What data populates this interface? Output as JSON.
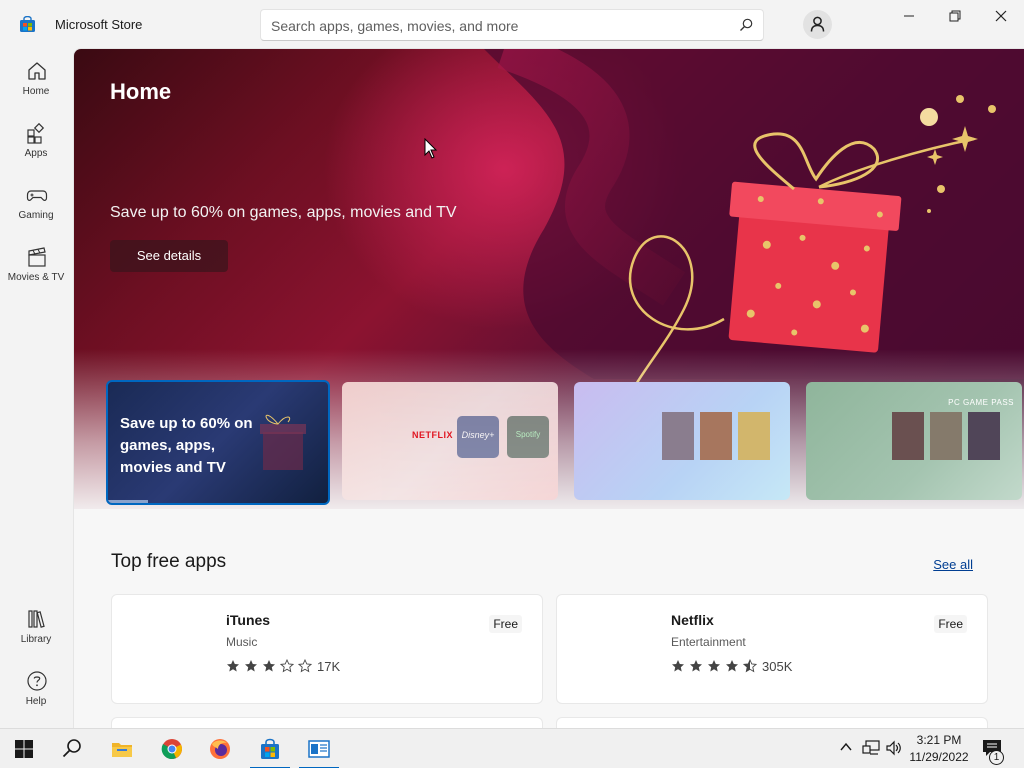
{
  "window": {
    "title": "Microsoft Store",
    "minimize_icon": "minimize-icon",
    "maximize_icon": "restore-icon",
    "close_icon": "close-icon"
  },
  "search": {
    "placeholder": "Search apps, games, movies, and more",
    "value": ""
  },
  "sidebar": {
    "items": [
      {
        "label": "Home",
        "icon": "home-icon"
      },
      {
        "label": "Apps",
        "icon": "apps-icon"
      },
      {
        "label": "Gaming",
        "icon": "gaming-icon"
      },
      {
        "label": "Movies & TV",
        "icon": "movies-icon"
      }
    ],
    "bottom": [
      {
        "label": "Library",
        "icon": "library-icon"
      },
      {
        "label": "Help",
        "icon": "help-icon"
      }
    ]
  },
  "hero": {
    "title": "Home",
    "subtitle": "Save up to 60% on games, apps, movies and TV",
    "button": "See details"
  },
  "carousel": {
    "cards": [
      {
        "text": "Save up to 60% on games, apps, movies and TV",
        "active": true
      },
      {
        "text": "NETFLIX"
      },
      {
        "text": ""
      },
      {
        "text": "PC GAME PASS"
      }
    ],
    "streaming_labels": [
      "Disney+",
      "Spotify"
    ]
  },
  "top_free_apps": {
    "title": "Top free apps",
    "see_all": "See all",
    "apps": [
      {
        "name": "iTunes",
        "category": "Music",
        "price": "Free",
        "rating": 3,
        "rating_count": "17K"
      },
      {
        "name": "Netflix",
        "category": "Entertainment",
        "price": "Free",
        "rating": 4.5,
        "rating_count": "305K"
      }
    ]
  },
  "taskbar": {
    "time": "3:21 PM",
    "date": "11/29/2022",
    "notification_count": "1",
    "icons": [
      "start-icon",
      "search-icon",
      "file-explorer-icon",
      "chrome-icon",
      "firefox-icon",
      "store-icon",
      "app-icon"
    ]
  },
  "colors": {
    "accent": "#0067c0",
    "hero_base": "#8c1330",
    "gift_red": "#e8344a",
    "gold": "#e8c46a"
  }
}
